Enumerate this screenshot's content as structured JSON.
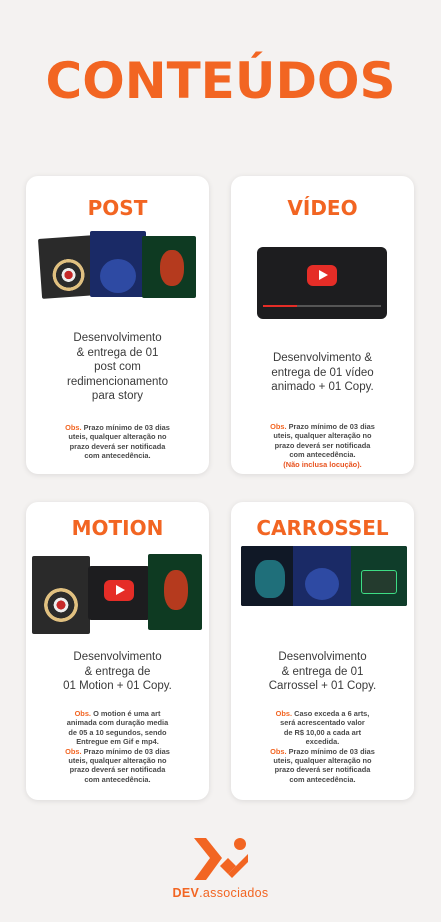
{
  "page": {
    "title": "CONTEÚDOS",
    "colors": {
      "accent": "#f26522",
      "background": "#f4f2f1",
      "card": "#ffffff",
      "youtube": "#e52d27"
    }
  },
  "cards": [
    {
      "title": "POST",
      "desc": [
        "Desenvolvimento",
        "& entrega de 01",
        "post com",
        "redimencionamento",
        "para story"
      ],
      "obs_label": "Obs.",
      "obs": [
        "Prazo mínimo de 03 dias",
        "uteis, qualquer alteração no",
        "prazo deverá ser notificada",
        "com antecedência."
      ]
    },
    {
      "title": "VÍDEO",
      "desc": [
        "Desenvolvimento &",
        "entrega de 01 vídeo",
        "animado + 01 Copy."
      ],
      "obs_label": "Obs.",
      "obs": [
        "Prazo mínimo de 03 dias",
        "uteis, qualquer alteração no",
        "prazo deverá ser notificada",
        "com antecedência."
      ],
      "obs_note": "(Não inclusa locução)."
    },
    {
      "title": "MOTION",
      "desc": [
        "Desenvolvimento",
        "& entrega de",
        "01 Motion + 01 Copy."
      ],
      "obs_label": "Obs.",
      "obs": [
        "O motion é uma art",
        "animada com duração media",
        "de 05 a 10 segundos, sendo",
        "Entregue em Gif e mp4."
      ],
      "obs2_label": "Obs.",
      "obs2": [
        "Prazo mínimo de 03 dias",
        "uteis, qualquer alteração no",
        "prazo deverá ser notificada",
        "com antecedência."
      ]
    },
    {
      "title": "CARROSSEL",
      "desc": [
        "Desenvolvimento",
        "& entrega de 01",
        "Carrossel + 01 Copy."
      ],
      "obs_label": "Obs.",
      "obs": [
        "Caso exceda a 6 arts,",
        "será acrescentado valor",
        "de R$ 10,00 a cada art",
        "excedida."
      ],
      "obs2_label": "Obs.",
      "obs2": [
        "Prazo mínimo de 03 dias",
        "uteis, qualquer alteração no",
        "prazo deverá ser notificada",
        "com antecedência."
      ]
    }
  ],
  "footer": {
    "brand_bold": "DEV",
    "brand_rest": ".associados",
    "logo_icon": "dev-associados-logo-icon"
  }
}
